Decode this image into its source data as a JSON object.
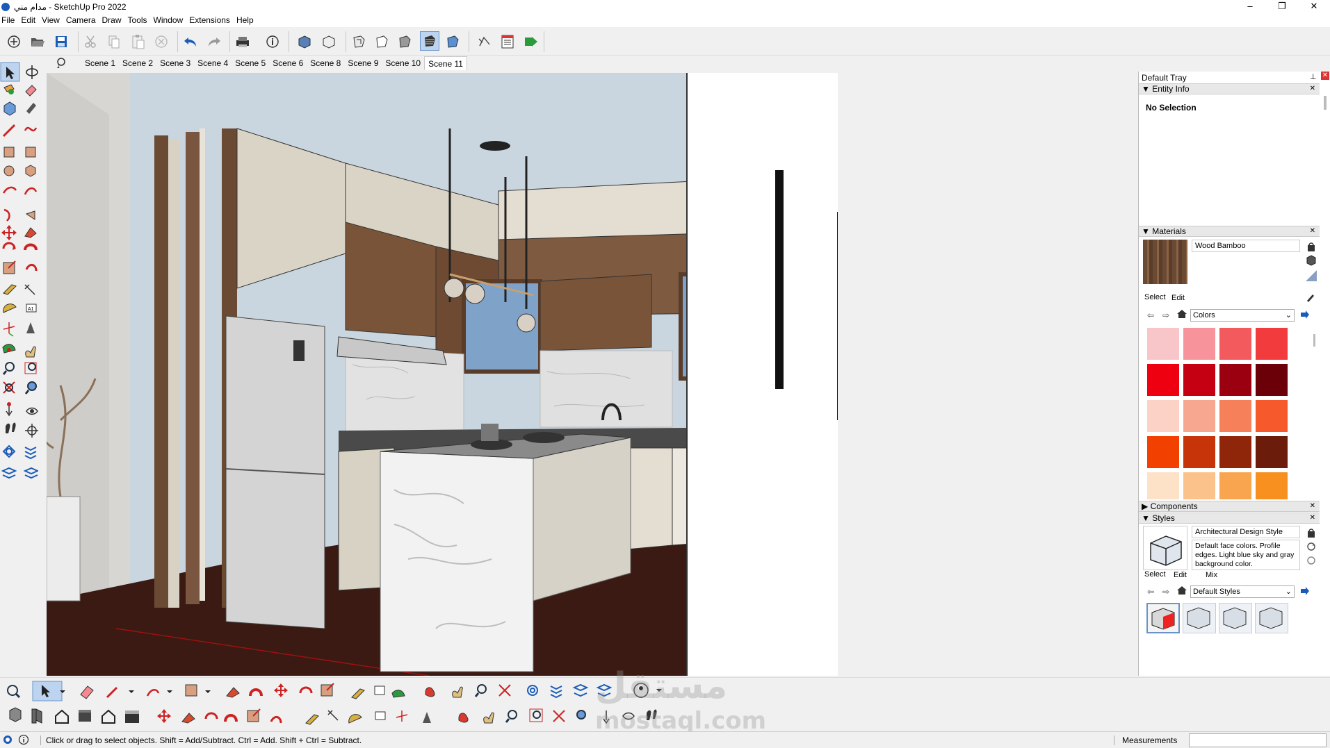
{
  "window": {
    "title": "مدام مني - SketchUp Pro 2022",
    "controls": [
      "–",
      "❐",
      "✕"
    ]
  },
  "menu": [
    "File",
    "Edit",
    "View",
    "Camera",
    "Draw",
    "Tools",
    "Window",
    "Extensions",
    "Help"
  ],
  "scenes": [
    "Scene 1",
    "Scene 2",
    "Scene 3",
    "Scene 4",
    "Scene 5",
    "Scene 6",
    "Scene 8",
    "Scene 9",
    "Scene 10",
    "Scene 11"
  ],
  "active_scene": "Scene 11",
  "tray": {
    "title": "Default Tray",
    "entity_info": {
      "header": "Entity Info",
      "value": "No Selection"
    },
    "materials": {
      "header": "Materials",
      "current": "Wood Bamboo",
      "tabs": [
        "Select",
        "Edit"
      ],
      "library": "Colors",
      "swatch_colors": [
        "#f8c5c8",
        "#f7949b",
        "#f25a5e",
        "#f23b3c",
        "#ef0010",
        "#c40012",
        "#9a0010",
        "#6b0008",
        "#fcd2c6",
        "#f7a78f",
        "#f6805a",
        "#f65a2c",
        "#f24000",
        "#c7340a",
        "#8f260a",
        "#6b1c0a",
        "#fde2c8",
        "#fcc28b",
        "#f9a550",
        "#f7901e",
        "#f28a00",
        "#c96c00",
        "#8e4c00",
        "#6b3800"
      ]
    },
    "components": {
      "header": "Components"
    },
    "styles": {
      "header": "Styles",
      "current": "Architectural Design Style",
      "description": "Default face colors. Profile edges. Light blue sky and gray background color.",
      "tabs": [
        "Select",
        "Edit",
        "Mix"
      ],
      "library": "Default Styles"
    }
  },
  "status": {
    "hint": "Click or drag to select objects. Shift = Add/Subtract. Ctrl = Add. Shift + Ctrl = Subtract.",
    "measurements_label": "Measurements",
    "measurements_value": ""
  },
  "watermark": {
    "line1": "مستقل",
    "line2": "mostaql.com"
  },
  "icons": {
    "main": [
      "new-icon",
      "open-icon",
      "save-icon",
      "cut-icon",
      "copy-icon",
      "paste-icon",
      "erase-icon",
      "undo-icon",
      "redo-icon",
      "print-icon",
      "model-info-icon",
      "iso-view-icon",
      "top-view-icon",
      "xray-icon",
      "wireframe-icon",
      "hidden-line-icon",
      "shaded-icon",
      "shaded-textures-icon",
      "monochrome-icon",
      "send-to-layout-icon",
      "generate-report-icon",
      "extension-icon"
    ]
  }
}
